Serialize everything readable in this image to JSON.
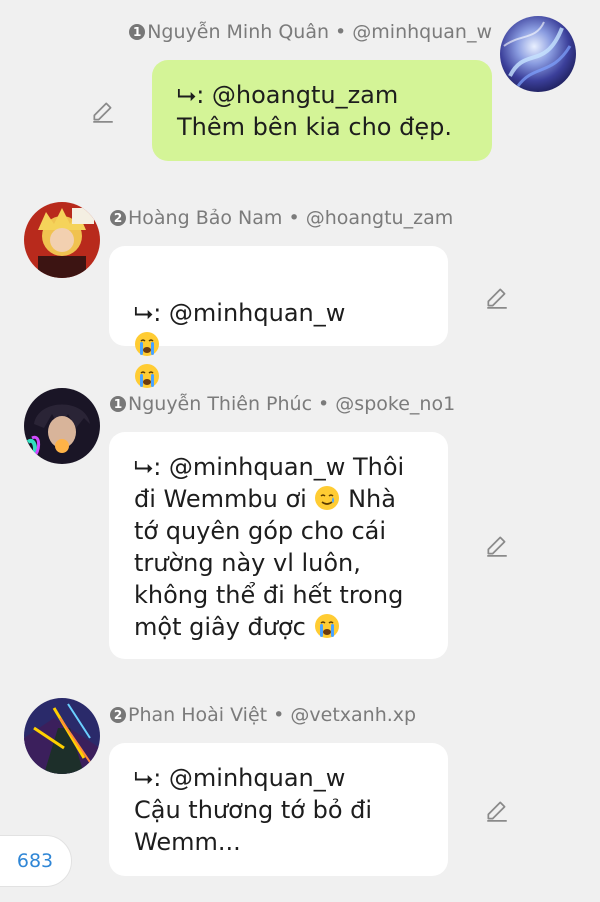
{
  "messages": [
    {
      "rank": "1",
      "author": "Nguyễn Minh Quân",
      "handle": "@minhquan_w",
      "header": "Nguyễn Minh Quân • @minhquan_w",
      "text": "⮡: @hoangtu_zam\nThêm bên kia cho đẹp."
    },
    {
      "rank": "2",
      "author": "Hoàng Bảo Nam",
      "handle": "@hoangtu_zam",
      "header": "Hoàng Bảo Nam • @hoangtu_zam",
      "text": "⮡: @minhquan_w"
    },
    {
      "rank": "1",
      "author": "Nguyễn Thiên Phúc",
      "handle": "@spoke_no1",
      "header": "Nguyễn Thiên Phúc • @spoke_no1",
      "text_a": "⮡: @minhquan_w Thôi\nđi Wemmbu ơi",
      "text_b": "Nhà\ntớ quyên góp cho cái\ntrường này vl luôn,\nkhông thể đi hết  trong\nmột giây được"
    },
    {
      "rank": "2",
      "author": "Phan Hoài Việt",
      "handle": "@vetxanh.xp",
      "header": "Phan Hoài Việt • @vetxanh.xp",
      "text": "⮡: @minhquan_w\nCậu thương tớ bỏ đi\nWemm..."
    }
  ],
  "counter": "683",
  "colors": {
    "background": "#f0f0f0",
    "self_bubble": "#d4f497",
    "other_bubble": "#ffffff",
    "counter_text": "#2f86d6"
  },
  "icons": [
    "edit-icon",
    "crying-face-emoji",
    "smiling-face-with-tear-emoji"
  ]
}
